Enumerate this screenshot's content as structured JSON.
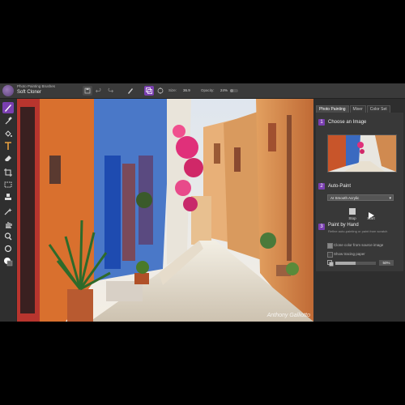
{
  "brush": {
    "category": "Photo Painting Brushes",
    "name": "Soft Cloner"
  },
  "toolbar": {
    "size_label": "Size:",
    "size_value": "36.9",
    "opacity_label": "Opacity:",
    "opacity_value": "24%"
  },
  "tools": [
    "brush-tool",
    "dropper-tool",
    "paint-bucket-tool",
    "text-tool",
    "eraser-tool",
    "crop-tool",
    "rectangle-select-tool",
    "stamp-tool",
    "magic-wand-tool",
    "grab-tool",
    "magnifier-tool",
    "rotate-tool",
    "color-swatch"
  ],
  "panel": {
    "tabs": [
      {
        "label": "Photo Painting",
        "active": true
      },
      {
        "label": "Mixer",
        "active": false
      },
      {
        "label": "Color Set",
        "active": false
      }
    ],
    "step1": {
      "number": "1",
      "title": "Choose an Image"
    },
    "step2": {
      "number": "2",
      "title": "Auto-Paint",
      "style": "AI Smooth Acrylic"
    },
    "controls": {
      "stop": "Stop",
      "start": "Start"
    },
    "step3": {
      "number": "3",
      "title": "Paint by Hand",
      "subtitle": "Refine auto-painting or paint from scratch"
    },
    "options": {
      "clone_color": "Clone color from source image",
      "tracing_paper": "Show tracing paper"
    },
    "tracing_opacity": "50%"
  },
  "canvas": {
    "watermark": "Anthony Galliotto"
  },
  "colors": {
    "accent": "#7a3fb0",
    "panel_bg": "#2e2e2e"
  }
}
